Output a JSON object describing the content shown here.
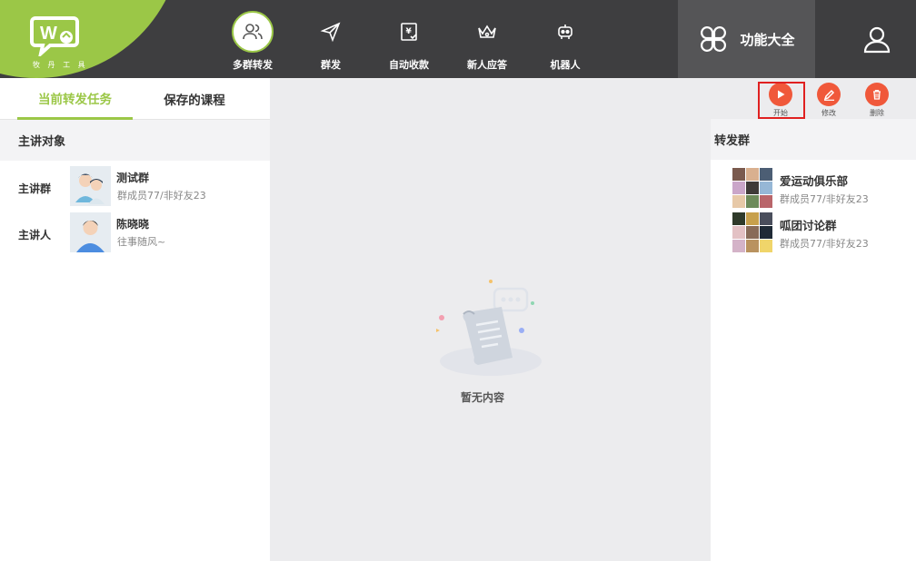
{
  "app": {
    "logo_text": "牧 丹 工 具",
    "brand_color": "#9bc747",
    "accent_color": "#f0583a"
  },
  "nav": {
    "items": [
      {
        "label": "多群转发",
        "icon": "users-icon",
        "active": true
      },
      {
        "label": "群发",
        "icon": "send-icon",
        "active": false
      },
      {
        "label": "自动收款",
        "icon": "payment-icon",
        "active": false
      },
      {
        "label": "新人应答",
        "icon": "crown-icon",
        "active": false
      },
      {
        "label": "机器人",
        "icon": "robot-icon",
        "active": false
      }
    ],
    "func_all_label": "功能大全"
  },
  "tabs": [
    {
      "label": "当前转发任务",
      "active": true
    },
    {
      "label": "保存的课程",
      "active": false
    }
  ],
  "left": {
    "section_title": "主讲对象",
    "rows": [
      {
        "label": "主讲群",
        "name": "测试群",
        "sub": "群成员77/非好友23"
      },
      {
        "label": "主讲人",
        "name": "陈晓晓",
        "sub": "往事随风~"
      }
    ]
  },
  "center": {
    "empty_text": "暂无内容"
  },
  "actions": [
    {
      "label": "开始",
      "icon": "play-icon"
    },
    {
      "label": "修改",
      "icon": "edit-icon"
    },
    {
      "label": "删除",
      "icon": "trash-icon"
    }
  ],
  "right": {
    "section_title": "转发群",
    "groups": [
      {
        "name": "爱运动俱乐部",
        "sub": "群成员77/非好友23"
      },
      {
        "name": "呱团讨论群",
        "sub": "群成员77/非好友23"
      }
    ]
  }
}
